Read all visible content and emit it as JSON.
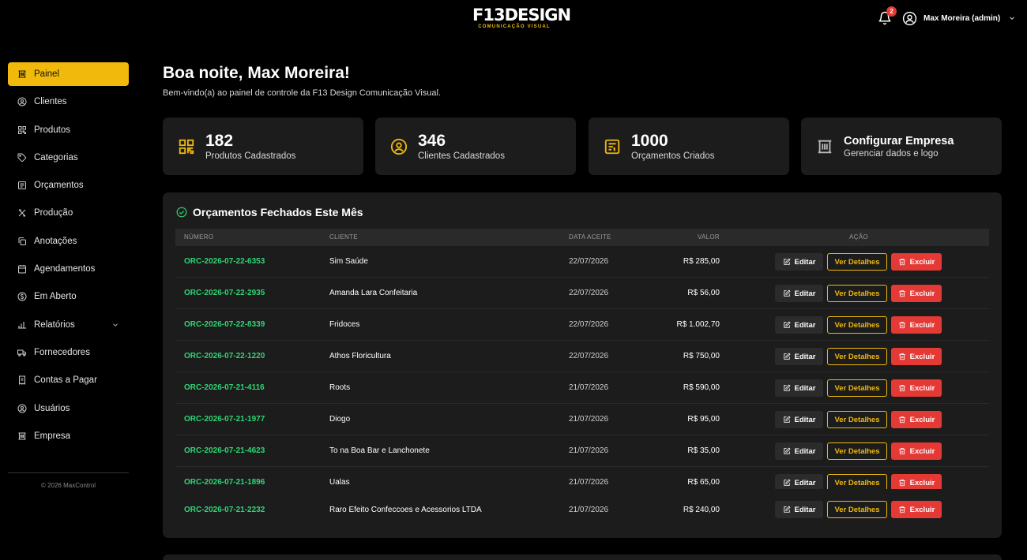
{
  "header": {
    "logo_text": "F13DESIGN",
    "logo_sub": "COMUNICAÇÃO VISUAL",
    "notification_count": "2",
    "user_name": "Max Moreira (admin)"
  },
  "sidebar": {
    "items": [
      {
        "label": "Painel",
        "icon": "building-icon"
      },
      {
        "label": "Clientes",
        "icon": "user-circle-icon"
      },
      {
        "label": "Produtos",
        "icon": "grid-icon"
      },
      {
        "label": "Categorias",
        "icon": "tag-icon"
      },
      {
        "label": "Orçamentos",
        "icon": "document-icon"
      },
      {
        "label": "Produção",
        "icon": "tools-icon"
      },
      {
        "label": "Anotações",
        "icon": "copy-icon"
      },
      {
        "label": "Agendamentos",
        "icon": "calendar-icon"
      },
      {
        "label": "Em Aberto",
        "icon": "dollar-icon"
      },
      {
        "label": "Relatórios",
        "icon": "bar-chart-icon"
      },
      {
        "label": "Fornecedores",
        "icon": "truck-icon"
      },
      {
        "label": "Contas a Pagar",
        "icon": "receipt-icon"
      },
      {
        "label": "Usuários",
        "icon": "user-circle-icon"
      },
      {
        "label": "Empresa",
        "icon": "building-icon"
      }
    ],
    "copyright": "© 2026 MaxControl"
  },
  "main": {
    "greeting": "Boa noite, Max Moreira!",
    "welcome": "Bem-vindo(a) ao painel de controle da F13 Design Comunicação Visual."
  },
  "stats": [
    {
      "value": "182",
      "label": "Produtos Cadastrados"
    },
    {
      "value": "346",
      "label": "Clientes Cadastrados"
    },
    {
      "value": "1000",
      "label": "Orçamentos Criados"
    },
    {
      "title": "Configurar Empresa",
      "label": "Gerenciar dados e logo"
    }
  ],
  "table": {
    "title": "Orçamentos Fechados Este Mês",
    "headers": {
      "numero": "NÚMERO",
      "cliente": "CLIENTE",
      "data": "DATA ACEITE",
      "valor": "VALOR",
      "acao": "AÇÃO"
    },
    "buttons": {
      "edit": "Editar",
      "details": "Ver Detalhes",
      "delete": "Excluir"
    },
    "rows": [
      {
        "numero": "ORC-2026-07-22-6353",
        "cliente": "Sim Saúde",
        "data": "22/07/2026",
        "valor": "R$ 285,00"
      },
      {
        "numero": "ORC-2026-07-22-2935",
        "cliente": "Amanda Lara Confeitaria",
        "data": "22/07/2026",
        "valor": "R$ 56,00"
      },
      {
        "numero": "ORC-2026-07-22-8339",
        "cliente": "Fridoces",
        "data": "22/07/2026",
        "valor": "R$ 1.002,70"
      },
      {
        "numero": "ORC-2026-07-22-1220",
        "cliente": "Athos Floricultura",
        "data": "22/07/2026",
        "valor": "R$ 750,00"
      },
      {
        "numero": "ORC-2026-07-21-4116",
        "cliente": "Roots",
        "data": "21/07/2026",
        "valor": "R$ 590,00"
      },
      {
        "numero": "ORC-2026-07-21-1977",
        "cliente": "Diogo",
        "data": "21/07/2026",
        "valor": "R$ 95,00"
      },
      {
        "numero": "ORC-2026-07-21-4623",
        "cliente": "To na Boa Bar e Lanchonete",
        "data": "21/07/2026",
        "valor": "R$ 35,00"
      },
      {
        "numero": "ORC-2026-07-21-1896",
        "cliente": "Ualas",
        "data": "21/07/2026",
        "valor": "R$ 65,00"
      }
    ],
    "last_row": {
      "numero": "ORC-2026-07-21-2232",
      "cliente": "Raro Efeito Confeccoes e Acessorios LTDA",
      "data": "21/07/2026",
      "valor": "R$ 240,00"
    }
  },
  "colors": {
    "accent": "#f0b90b",
    "danger": "#e53935",
    "success": "#2ed573",
    "card": "#1c1c1c"
  }
}
